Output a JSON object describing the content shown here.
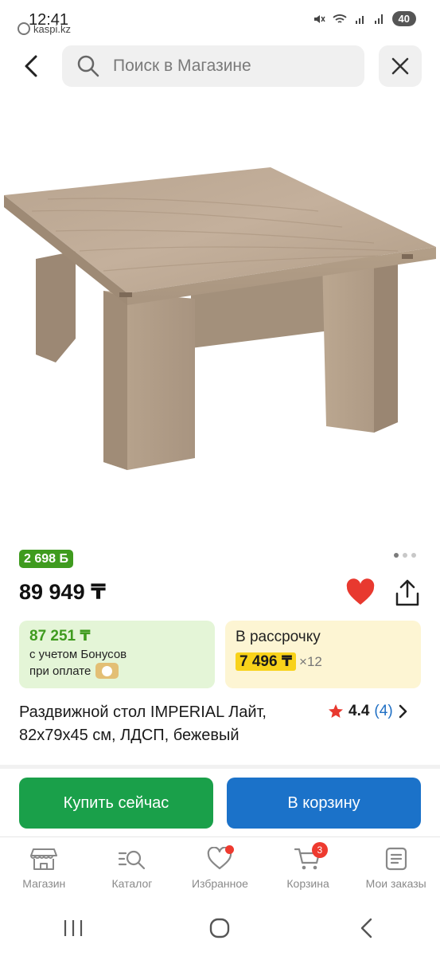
{
  "status_bar": {
    "time": "12:41",
    "app_label": "kaspi.kz",
    "battery": "40"
  },
  "header": {
    "search_placeholder": "Поиск в Магазине"
  },
  "product": {
    "bonus_badge": "2 698 Б",
    "price": "89 949 ₸",
    "image_page": "1 of 3",
    "bonus_card": {
      "price": "87 251 ₸",
      "line1": "с учетом Бонусов",
      "line2": "при оплате"
    },
    "installment_card": {
      "title": "В рассрочку",
      "price": "7 496 ₸",
      "multiplier": "×12"
    },
    "title": "Раздвижной стол IMPERIAL Лайт, 82x79x45 см, ЛДСП, бежевый",
    "rating": "4.4",
    "reviews": "(4)"
  },
  "actions": {
    "buy_now": "Купить сейчас",
    "add_to_cart": "В корзину"
  },
  "bottom_nav": {
    "items": [
      {
        "label": "Магазин",
        "icon": "store-icon"
      },
      {
        "label": "Каталог",
        "icon": "catalog-search-icon"
      },
      {
        "label": "Избранное",
        "icon": "heart-icon"
      },
      {
        "label": "Корзина",
        "icon": "cart-icon"
      },
      {
        "label": "Мои заказы",
        "icon": "orders-icon"
      }
    ],
    "cart_count": "3"
  },
  "colors": {
    "buy_green": "#1aa04a",
    "cart_blue": "#1b72c9",
    "bonus_green": "#3f9b1f",
    "installment_yellow": "#f8d21a",
    "favorite_red": "#e8392f"
  }
}
